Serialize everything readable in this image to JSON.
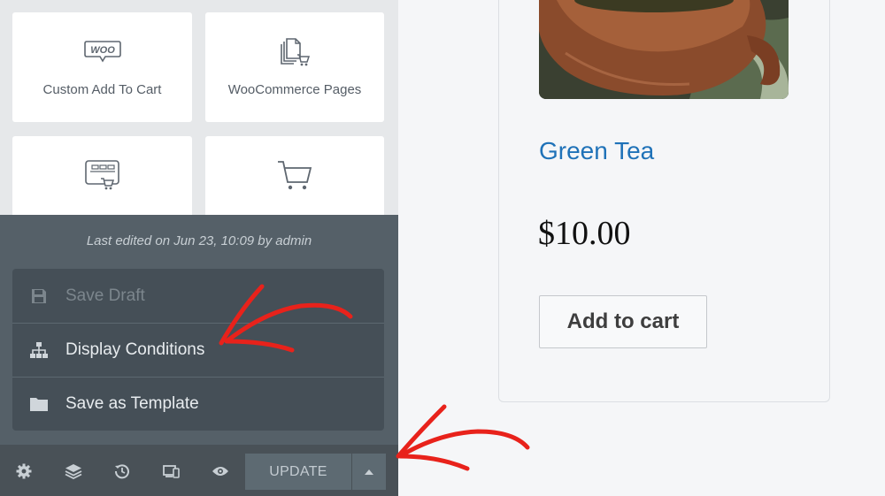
{
  "widgets": [
    {
      "label": "Custom Add To Cart",
      "icon": "woo-icon"
    },
    {
      "label": "WooCommerce Pages",
      "icon": "pages-cart-icon"
    },
    {
      "label": "",
      "icon": "menu-cart-icon"
    },
    {
      "label": "",
      "icon": "cart-icon"
    }
  ],
  "last_edited": "Last edited on Jun 23, 10:09 by admin",
  "menu": [
    {
      "label": "Save Draft",
      "icon": "save-icon",
      "disabled": true
    },
    {
      "label": "Display Conditions",
      "icon": "sitemap-icon"
    },
    {
      "label": "Save as Template",
      "icon": "folder-icon"
    }
  ],
  "footer": {
    "icons": [
      "gear-icon",
      "layers-icon",
      "history-icon",
      "responsive-icon",
      "eye-icon"
    ],
    "update_label": "UPDATE",
    "caret_icon": "caret-up-icon"
  },
  "product": {
    "title": "Green Tea",
    "price": "$10.00",
    "button_label": "Add to cart"
  },
  "colors": {
    "panel_bg": "#e6e8ea",
    "popup_bg": "#556068",
    "menu_bg": "#454f57",
    "footer_bg": "#495157",
    "link_blue": "#1f72b8",
    "arrow_red": "#e8221b"
  }
}
